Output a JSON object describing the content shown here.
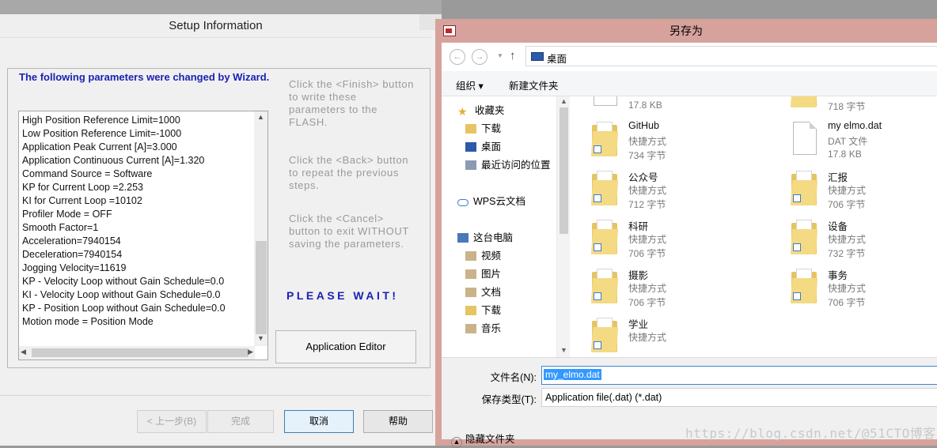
{
  "setup": {
    "title": "Setup Information",
    "heading": "The following parameters were changed by Wizard.",
    "params": [
      "High Position Reference Limit=1000",
      "Low Position Reference Limit=-1000",
      "Application Peak Current [A]=3.000",
      "Application Continuous  Current [A]=1.320",
      "Command Source = Software",
      "KP for Current Loop =2.253",
      "KI for Current Loop =10102",
      "Profiler Mode = OFF",
      "Smooth Factor=1",
      "Acceleration=7940154",
      "Deceleration=7940154",
      "Jogging Velocity=11619",
      "KP - Velocity Loop without Gain Schedule=0.0",
      "KI - Velocity Loop without Gain Schedule=0.0",
      "KP - Position Loop without Gain Schedule=0.0",
      "Motion mode = Position Mode"
    ],
    "hint_finish": "Click the <Finish> button to write these parameters to the FLASH.",
    "hint_back": "Click the <Back> button to repeat the previous steps.",
    "hint_cancel": "Click the <Cancel> button to exit WITHOUT saving the parameters.",
    "please_wait": "PLEASE WAIT!",
    "app_editor": "Application Editor",
    "btn_back": "< 上一步(B)",
    "btn_finish": "完成",
    "btn_cancel": "取消",
    "btn_help": "帮助"
  },
  "save": {
    "title": "另存为",
    "address": "桌面",
    "toolbar_organize": "组织 ▾",
    "toolbar_newfolder": "新建文件夹",
    "nav": {
      "favorites": "收藏夹",
      "downloads": "下载",
      "desktop": "桌面",
      "recent": "最近访问的位置",
      "wps": "WPS云文档",
      "thispc": "这台电脑",
      "videos": "视频",
      "pictures": "图片",
      "documents": "文档",
      "downloads2": "下载",
      "music": "音乐"
    },
    "files": {
      "top_left_size": "17.8 KB",
      "top_right_size": "718 字节",
      "github": {
        "name": "GitHub",
        "type": "快捷方式",
        "size": "734 字节"
      },
      "myelmo": {
        "name": "my elmo.dat",
        "type": "DAT 文件",
        "size": "17.8 KB"
      },
      "gzh": {
        "name": "公众号",
        "type": "快捷方式",
        "size": "712 字节"
      },
      "huibao": {
        "name": "汇报",
        "type": "快捷方式",
        "size": "706 字节"
      },
      "keyan": {
        "name": "科研",
        "type": "快捷方式",
        "size": "706 字节"
      },
      "shebei": {
        "name": "设备",
        "type": "快捷方式",
        "size": "732 字节"
      },
      "sheying": {
        "name": "摄影",
        "type": "快捷方式",
        "size": "706 字节"
      },
      "shiwu": {
        "name": "事务",
        "type": "快捷方式",
        "size": "706 字节"
      },
      "xueye": {
        "name": "学业",
        "type": "快捷方式"
      }
    },
    "filename_label": "文件名(N):",
    "filename_value": "my_elmo.dat",
    "filetype_label": "保存类型(T):",
    "filetype_value": "Application file(.dat) (*.dat)",
    "hide_folders": "隐藏文件夹"
  },
  "watermark": "https://blog.csdn.net/@51CTO博客"
}
